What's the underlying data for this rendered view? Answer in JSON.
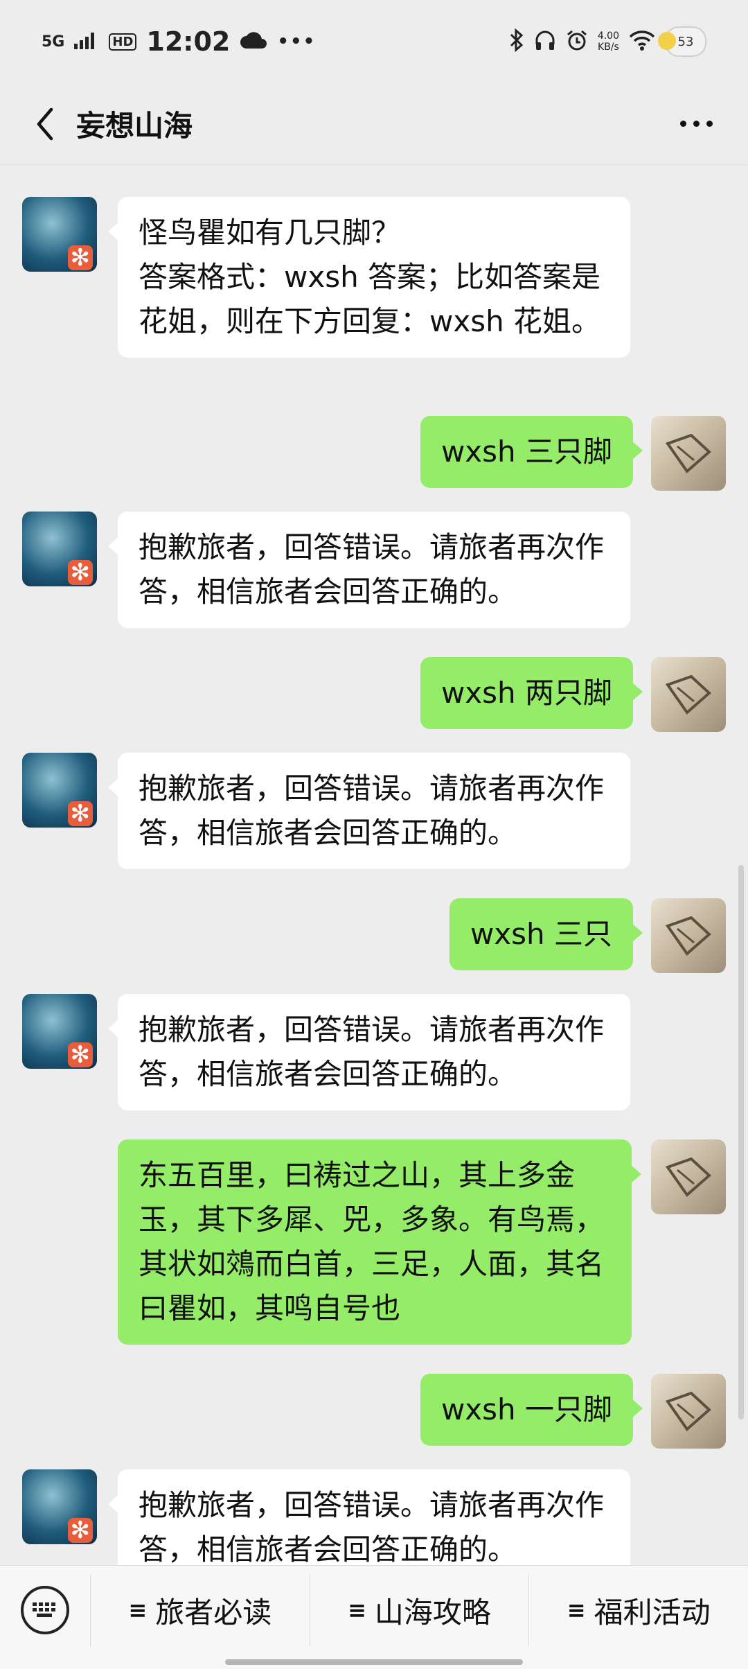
{
  "status_bar": {
    "network": "5G",
    "hd": "HD",
    "time": "12:02",
    "dots": "•••",
    "speed_value": "4.00",
    "speed_unit": "KB/s",
    "battery": "53"
  },
  "header": {
    "title": "妄想山海"
  },
  "messages": [
    {
      "side": "left",
      "text": "怪鸟瞿如有几只脚？\n答案格式：wxsh 答案；比如答案是花姐，则在下方回复：wxsh 花姐。"
    },
    {
      "side": "right",
      "text": "wxsh 三只脚"
    },
    {
      "side": "left",
      "text": "抱歉旅者，回答错误。请旅者再次作答，相信旅者会回答正确的。"
    },
    {
      "side": "right",
      "text": "wxsh 两只脚"
    },
    {
      "side": "left",
      "text": "抱歉旅者，回答错误。请旅者再次作答，相信旅者会回答正确的。"
    },
    {
      "side": "right",
      "text": "wxsh 三只"
    },
    {
      "side": "left",
      "text": "抱歉旅者，回答错误。请旅者再次作答，相信旅者会回答正确的。"
    },
    {
      "side": "right",
      "text": "东五百里，曰祷过之山，其上多金玉，其下多犀、兕，多象。有鸟焉，其状如鵁而白首，三足，人面，其名曰瞿如，其鸣自号也"
    },
    {
      "side": "right",
      "text": "wxsh 一只脚"
    },
    {
      "side": "left",
      "text": "抱歉旅者，回答错误。请旅者再次作答，相信旅者会回答正确的。"
    }
  ],
  "bottom_menu": {
    "items": [
      {
        "icon": "≡",
        "label": "旅者必读"
      },
      {
        "icon": "≡",
        "label": "山海攻略"
      },
      {
        "icon": "≡",
        "label": "福利活动"
      }
    ]
  },
  "colors": {
    "background": "#ededed",
    "self_bubble": "#95ec69",
    "other_bubble": "#ffffff"
  }
}
